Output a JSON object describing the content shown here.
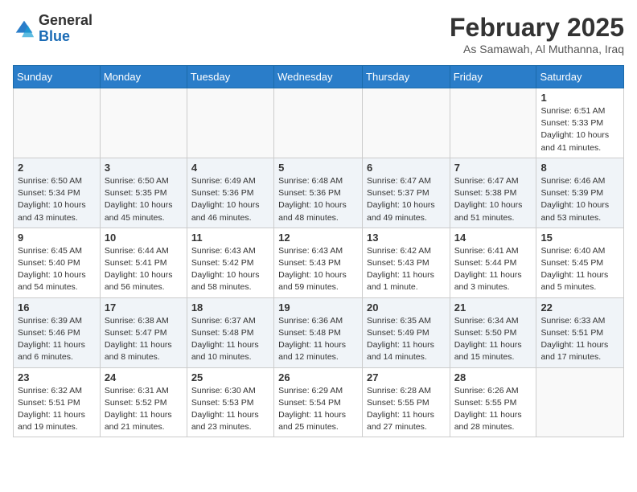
{
  "header": {
    "logo_general": "General",
    "logo_blue": "Blue",
    "month_title": "February 2025",
    "location": "As Samawah, Al Muthanna, Iraq"
  },
  "weekdays": [
    "Sunday",
    "Monday",
    "Tuesday",
    "Wednesday",
    "Thursday",
    "Friday",
    "Saturday"
  ],
  "weeks": [
    [
      {
        "day": null
      },
      {
        "day": null
      },
      {
        "day": null
      },
      {
        "day": null
      },
      {
        "day": null
      },
      {
        "day": null
      },
      {
        "day": "1",
        "info": "Sunrise: 6:51 AM\nSunset: 5:33 PM\nDaylight: 10 hours and 41 minutes."
      }
    ],
    [
      {
        "day": "2",
        "info": "Sunrise: 6:50 AM\nSunset: 5:34 PM\nDaylight: 10 hours and 43 minutes."
      },
      {
        "day": "3",
        "info": "Sunrise: 6:50 AM\nSunset: 5:35 PM\nDaylight: 10 hours and 45 minutes."
      },
      {
        "day": "4",
        "info": "Sunrise: 6:49 AM\nSunset: 5:36 PM\nDaylight: 10 hours and 46 minutes."
      },
      {
        "day": "5",
        "info": "Sunrise: 6:48 AM\nSunset: 5:36 PM\nDaylight: 10 hours and 48 minutes."
      },
      {
        "day": "6",
        "info": "Sunrise: 6:47 AM\nSunset: 5:37 PM\nDaylight: 10 hours and 49 minutes."
      },
      {
        "day": "7",
        "info": "Sunrise: 6:47 AM\nSunset: 5:38 PM\nDaylight: 10 hours and 51 minutes."
      },
      {
        "day": "8",
        "info": "Sunrise: 6:46 AM\nSunset: 5:39 PM\nDaylight: 10 hours and 53 minutes."
      }
    ],
    [
      {
        "day": "9",
        "info": "Sunrise: 6:45 AM\nSunset: 5:40 PM\nDaylight: 10 hours and 54 minutes."
      },
      {
        "day": "10",
        "info": "Sunrise: 6:44 AM\nSunset: 5:41 PM\nDaylight: 10 hours and 56 minutes."
      },
      {
        "day": "11",
        "info": "Sunrise: 6:43 AM\nSunset: 5:42 PM\nDaylight: 10 hours and 58 minutes."
      },
      {
        "day": "12",
        "info": "Sunrise: 6:43 AM\nSunset: 5:43 PM\nDaylight: 10 hours and 59 minutes."
      },
      {
        "day": "13",
        "info": "Sunrise: 6:42 AM\nSunset: 5:43 PM\nDaylight: 11 hours and 1 minute."
      },
      {
        "day": "14",
        "info": "Sunrise: 6:41 AM\nSunset: 5:44 PM\nDaylight: 11 hours and 3 minutes."
      },
      {
        "day": "15",
        "info": "Sunrise: 6:40 AM\nSunset: 5:45 PM\nDaylight: 11 hours and 5 minutes."
      }
    ],
    [
      {
        "day": "16",
        "info": "Sunrise: 6:39 AM\nSunset: 5:46 PM\nDaylight: 11 hours and 6 minutes."
      },
      {
        "day": "17",
        "info": "Sunrise: 6:38 AM\nSunset: 5:47 PM\nDaylight: 11 hours and 8 minutes."
      },
      {
        "day": "18",
        "info": "Sunrise: 6:37 AM\nSunset: 5:48 PM\nDaylight: 11 hours and 10 minutes."
      },
      {
        "day": "19",
        "info": "Sunrise: 6:36 AM\nSunset: 5:48 PM\nDaylight: 11 hours and 12 minutes."
      },
      {
        "day": "20",
        "info": "Sunrise: 6:35 AM\nSunset: 5:49 PM\nDaylight: 11 hours and 14 minutes."
      },
      {
        "day": "21",
        "info": "Sunrise: 6:34 AM\nSunset: 5:50 PM\nDaylight: 11 hours and 15 minutes."
      },
      {
        "day": "22",
        "info": "Sunrise: 6:33 AM\nSunset: 5:51 PM\nDaylight: 11 hours and 17 minutes."
      }
    ],
    [
      {
        "day": "23",
        "info": "Sunrise: 6:32 AM\nSunset: 5:51 PM\nDaylight: 11 hours and 19 minutes."
      },
      {
        "day": "24",
        "info": "Sunrise: 6:31 AM\nSunset: 5:52 PM\nDaylight: 11 hours and 21 minutes."
      },
      {
        "day": "25",
        "info": "Sunrise: 6:30 AM\nSunset: 5:53 PM\nDaylight: 11 hours and 23 minutes."
      },
      {
        "day": "26",
        "info": "Sunrise: 6:29 AM\nSunset: 5:54 PM\nDaylight: 11 hours and 25 minutes."
      },
      {
        "day": "27",
        "info": "Sunrise: 6:28 AM\nSunset: 5:55 PM\nDaylight: 11 hours and 27 minutes."
      },
      {
        "day": "28",
        "info": "Sunrise: 6:26 AM\nSunset: 5:55 PM\nDaylight: 11 hours and 28 minutes."
      },
      {
        "day": null
      }
    ]
  ]
}
